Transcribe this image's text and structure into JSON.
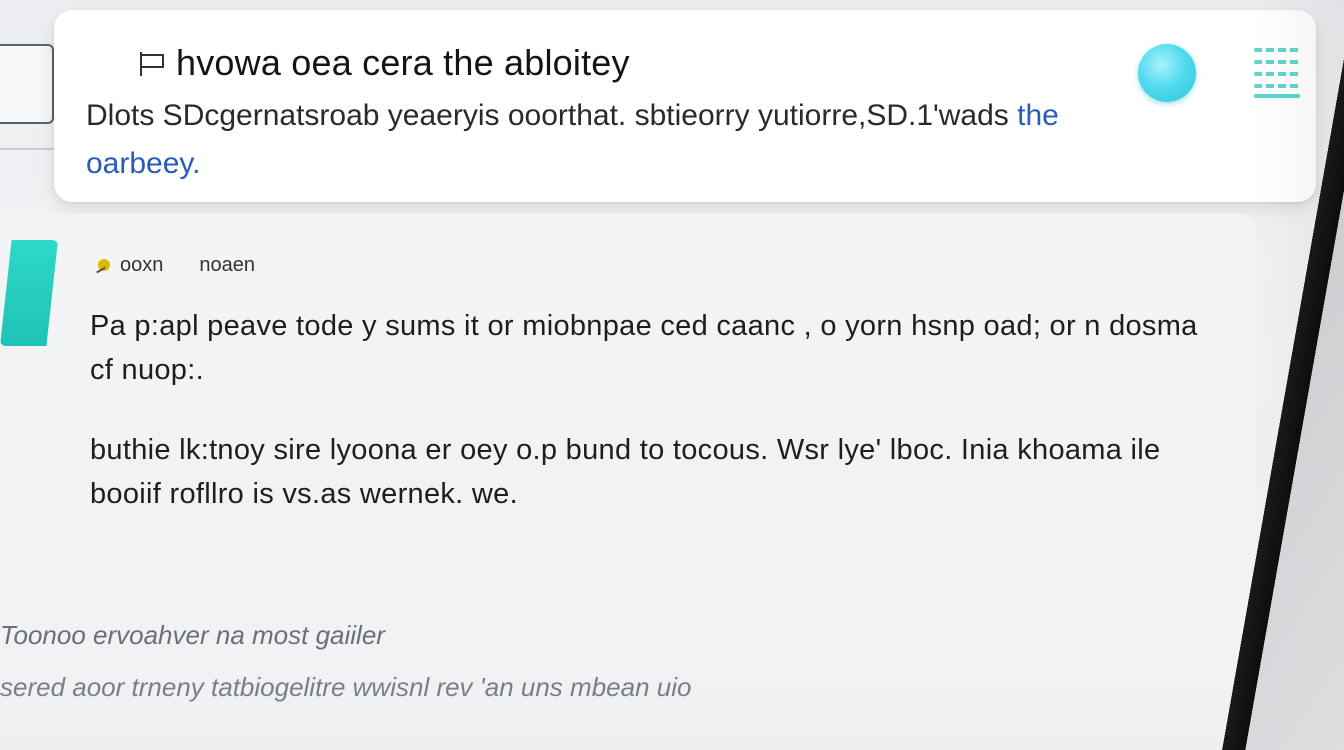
{
  "header": {
    "title": "hvowa oea cera the abloitey",
    "body_text": "Dlots SDcgernatsroab yeaeryis ooorthat. sbtieorry yutiorre,SD.1'wads",
    "body_link": "the oarbeey."
  },
  "post": {
    "author": "ooxn",
    "meta": "noaen",
    "paragraph_1": "Pa p:apl peave tode y sums it or miobnpae ced caanc , o yorn hsnp oad; or n dosma cf nuop:.",
    "paragraph_2": "buthie lk:tnoy sire lyoona er oey o.p bund to tocous. Wsr lye' lboc. Inia khoama ile booiif rofllro is vs.as wernek. we."
  },
  "footer": {
    "line_1": "Toonoo ervoahver na most gaiiler",
    "line_2": "sered aoor trneny tatbiogelitre wwisnl rev 'an uns mbean uio"
  },
  "icons": {
    "status_orb": "status-orb-icon",
    "menu": "menu-icon",
    "flag": "flag-icon",
    "pin": "pin-icon"
  },
  "colors": {
    "accent_teal": "#2ed8c8",
    "orb_cyan": "#53dbef",
    "link_blue": "#2a5bb8"
  }
}
